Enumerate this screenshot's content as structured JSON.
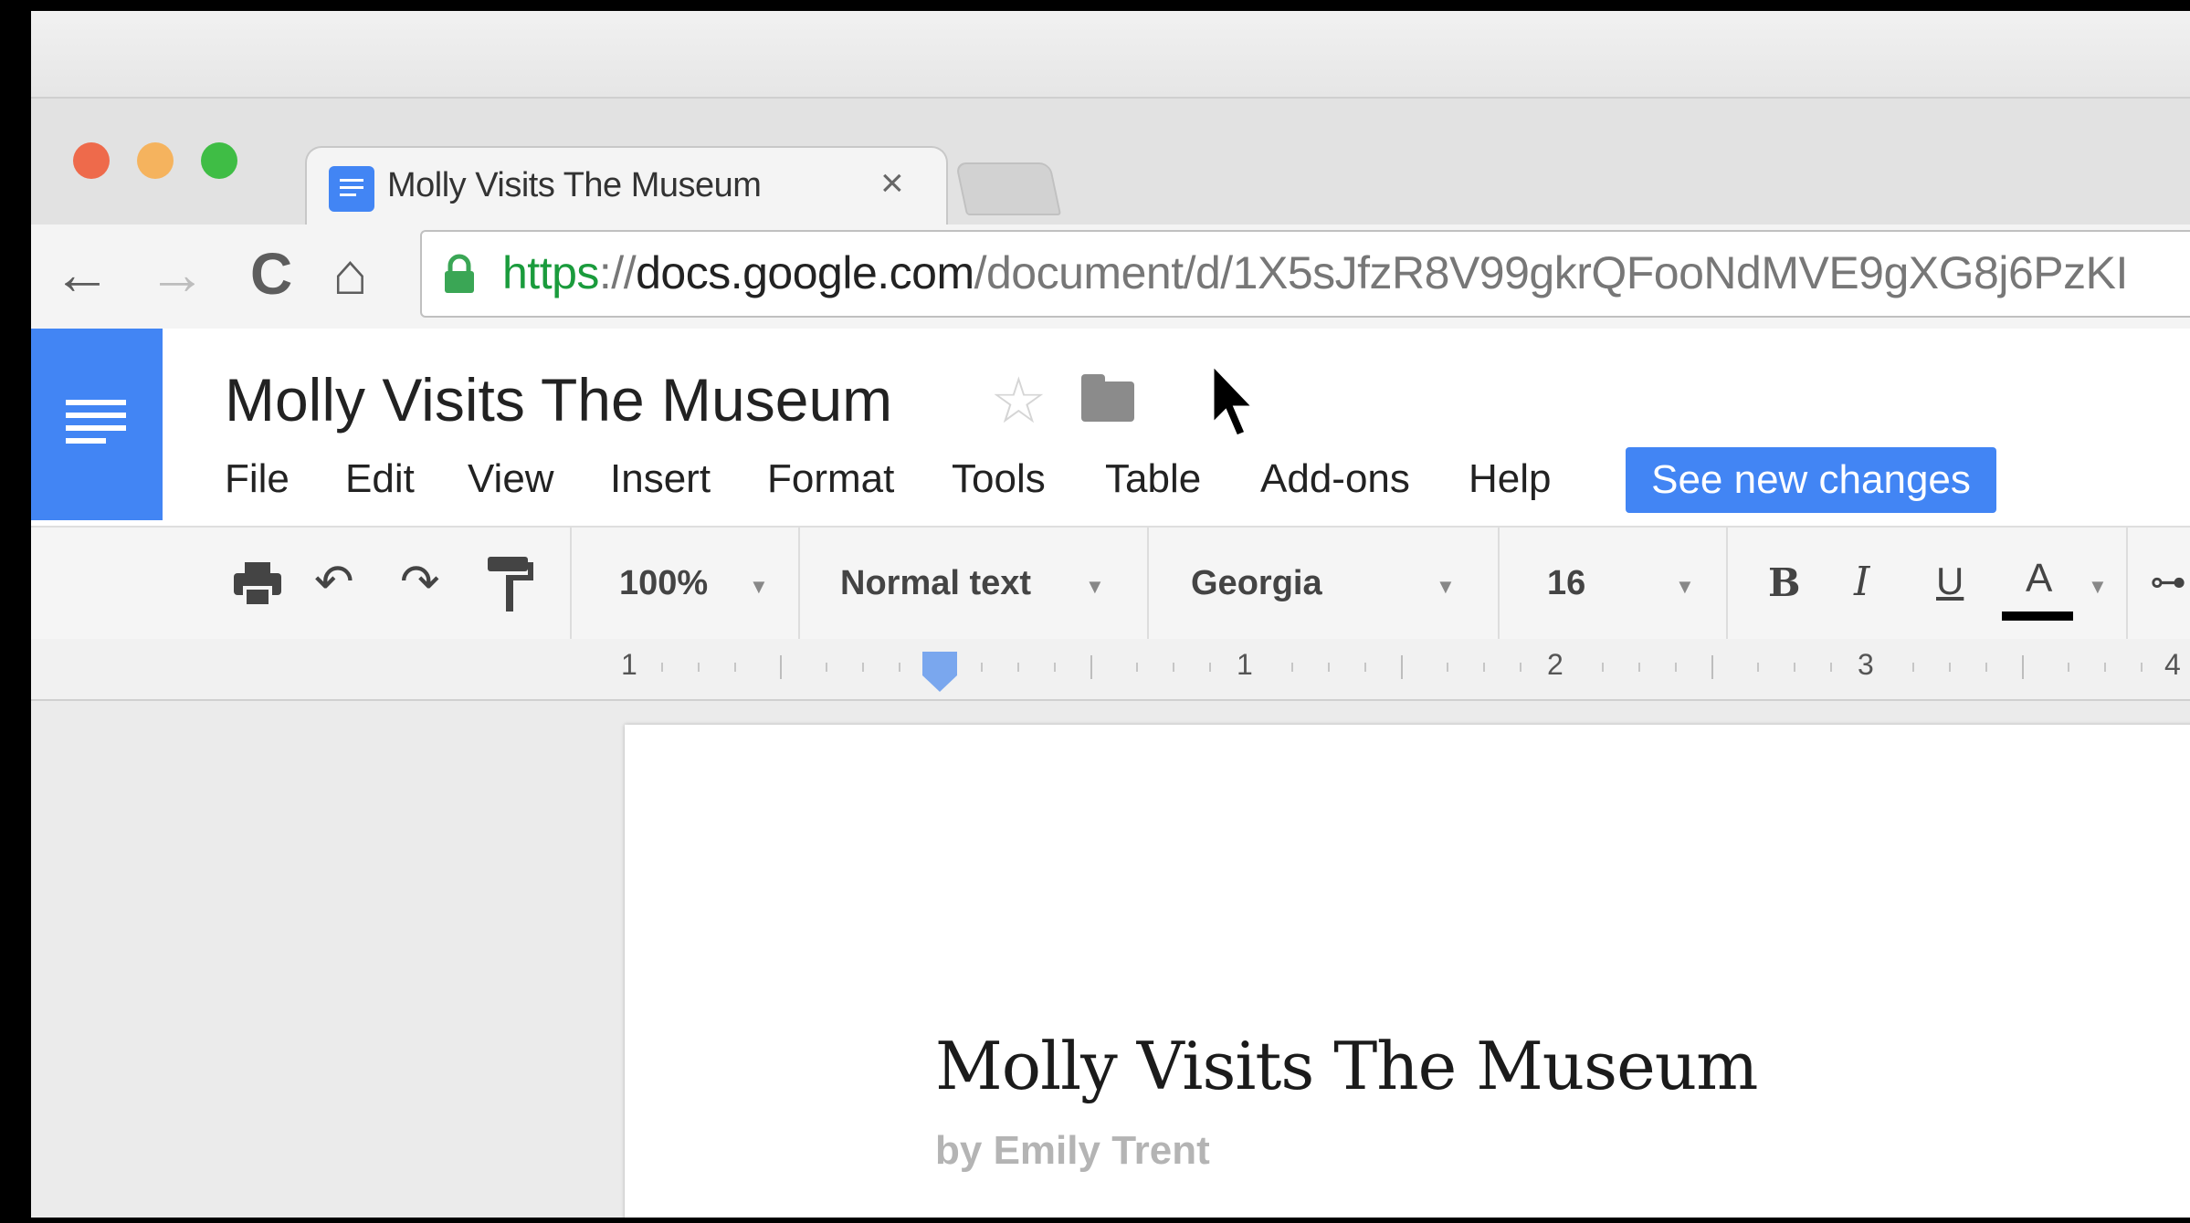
{
  "browser": {
    "tab": {
      "title": "Molly Visits The Museum",
      "close_glyph": "×"
    },
    "url": {
      "scheme": "https",
      "separator": "://",
      "host": "docs.google.com",
      "path": "/document/d/1X5sJfzR8V99gkrQFooNdMVE9gXG8j6PzKI"
    },
    "traffic_lights": {
      "close": "#ee6a4b",
      "minimize": "#f5b35e",
      "maximize": "#3fbd45"
    },
    "nav": {
      "back": "←",
      "forward": "→",
      "reload": "C",
      "home": "⌂"
    }
  },
  "docs": {
    "title": "Molly Visits The Museum",
    "menu": [
      "File",
      "Edit",
      "View",
      "Insert",
      "Format",
      "Tools",
      "Table",
      "Add-ons",
      "Help"
    ],
    "see_changes": "See new changes",
    "toolbar": {
      "zoom": "100%",
      "style": "Normal text",
      "font": "Georgia",
      "size": "16",
      "bold": "B",
      "italic": "I",
      "underline": "U",
      "text_color": "A",
      "text_color_value": "#000000"
    },
    "ruler_numbers": [
      "1",
      "1",
      "2",
      "3",
      "4"
    ]
  },
  "document": {
    "title": "Molly Visits The Museum",
    "byline": "by Emily Trent"
  },
  "colors": {
    "accent": "#4285f4",
    "url_green": "#1a9b3c"
  }
}
